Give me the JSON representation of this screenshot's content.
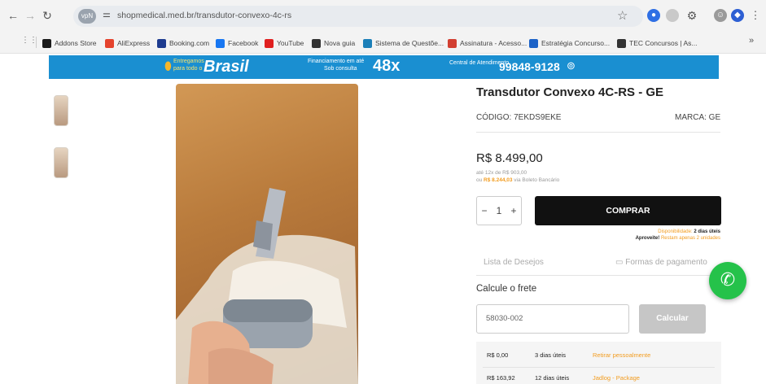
{
  "browser": {
    "url": "shopmedical.med.br/transdutor-convexo-4c-rs",
    "site_chip": "vpN",
    "bookmarks": [
      {
        "label": "Addons Store",
        "color": "#1a1a1a"
      },
      {
        "label": "AliExpress",
        "color": "#e5432d"
      },
      {
        "label": "Booking.com",
        "color": "#1d3b8f"
      },
      {
        "label": "Facebook",
        "color": "#1877f2"
      },
      {
        "label": "YouTube",
        "color": "#e02020"
      },
      {
        "label": "Nova guia",
        "color": "#333333"
      },
      {
        "label": "Sistema de Questõe...",
        "color": "#1b7fb8"
      },
      {
        "label": "Assinatura - Acesso...",
        "color": "#d23f31"
      },
      {
        "label": "Estratégia Concurso...",
        "color": "#1c62c7"
      },
      {
        "label": "TEC Concursos | As...",
        "color": "#333333"
      }
    ],
    "more_bookmarks": "»"
  },
  "banner": {
    "ship_small": "Entregamos para todo o",
    "ship_big": "Brasil",
    "financing_small": "Financiamento em até",
    "financing_small2": "Sob consulta",
    "financing_big": "48x",
    "support_label": "Central de Atendimento",
    "support_phone": "99848-9128"
  },
  "product": {
    "title": "Transdutor Convexo 4C-RS - GE",
    "code": "CÓDIGO: 7EKDS9EKE",
    "brand": "MARCA: GE",
    "price": "R$ 8.499,00",
    "installments": "até 12x de R$ 903,00",
    "boleto_prefix": "ou",
    "boleto_price": "R$ 8.244,03",
    "boleto_suffix": "via Boleto Bancário",
    "qty": "1",
    "qty_minus": "−",
    "qty_plus": "+",
    "buy_label": "COMPRAR",
    "avail_label": "Disponibilidade:",
    "avail_value": "2 dias úteis",
    "stock_label": "Aproveite!",
    "stock_value": "Restam apenas 2 unidades",
    "wishlist": "Lista de Desejos",
    "payment": "Formas de pagamento"
  },
  "shipping": {
    "title": "Calcule o frete",
    "cep": "58030-002",
    "calc_label": "Calcular",
    "rows": [
      {
        "price": "R$ 0,00",
        "days": "3 dias úteis",
        "method": "Retirar pessoalmente"
      },
      {
        "price": "R$ 163,92",
        "days": "12 dias úteis",
        "method": "Jadlog - Package"
      }
    ]
  },
  "colors": {
    "banner": "#1a8fd1",
    "accent": "#f29c1f",
    "whatsapp": "#25c24a"
  }
}
